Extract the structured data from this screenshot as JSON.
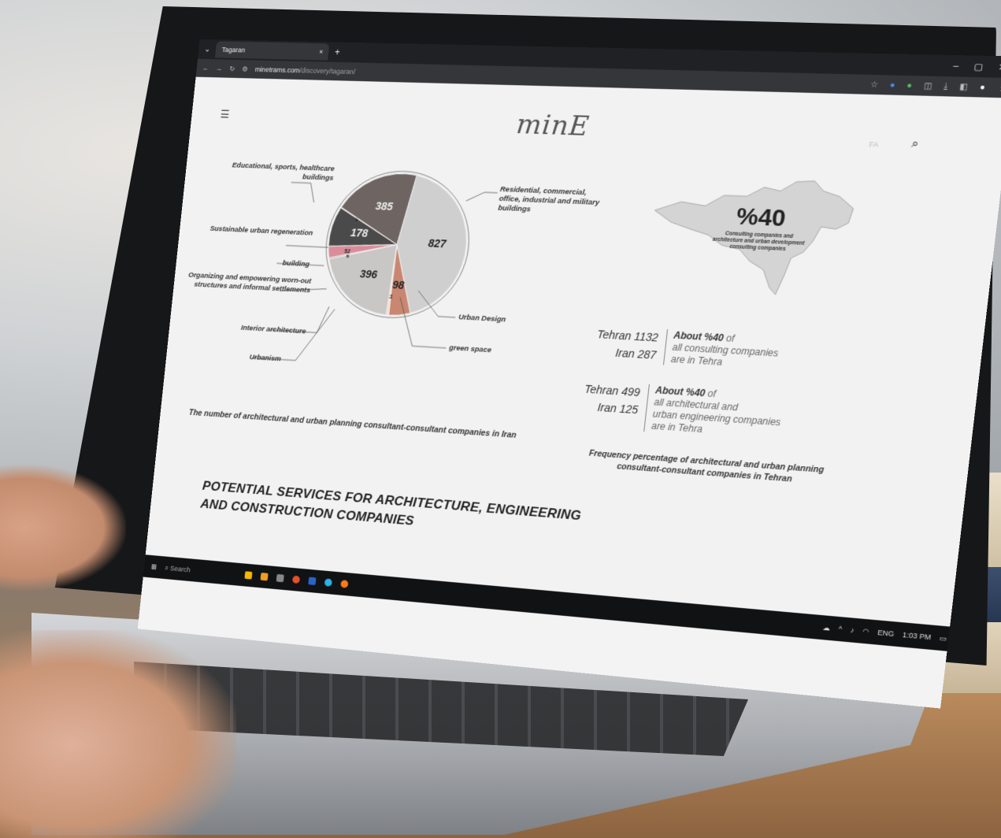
{
  "browser": {
    "tab_title": "Tagaran",
    "tab_close": "×",
    "new_tab": "+",
    "window_controls": [
      "–",
      "▢",
      "✕"
    ],
    "url_host": "minetrams.com",
    "url_path": "/discovery/tagaran/"
  },
  "site": {
    "logo": "minE",
    "lang": "FA"
  },
  "pie": {
    "labels": {
      "educational": "Educational, sports, healthcare buildings",
      "sustainable": "Sustainable urban regeneration",
      "building": "building",
      "organizing": "Organizing and empowering worn-out structures and informal settlements",
      "interior": "Interior architecture",
      "urbanism": "Urbanism",
      "residential": "Residential, commercial, office, industrial and military buildings",
      "urban_design": "Urban Design",
      "green_space": "green space"
    },
    "caption": "The number of architectural and urban planning consultant-consultant companies in Iran"
  },
  "chart_data": {
    "type": "pie",
    "categories": [
      "Residential, commercial, office, industrial and military buildings",
      "Urban Design",
      "green space",
      "Urbanism",
      "Interior architecture",
      "Organizing and empowering worn-out structures and informal settlements",
      "building",
      "Sustainable urban regeneration",
      "Educational, sports, healthcare buildings"
    ],
    "values": [
      827,
      98,
      11,
      396,
      6,
      52,
      178,
      3,
      385
    ],
    "value_labels": [
      "827",
      "98",
      "11",
      "396",
      "6",
      "52",
      "178",
      "3",
      "385"
    ],
    "colors": [
      "#cfcfcf",
      "#c98670",
      "#f3dcc8",
      "#c9c6c6",
      "#9a8f8a",
      "#d98d9a",
      "#4a4a4a",
      "#e0e0e0",
      "#6e6563"
    ],
    "title": "",
    "legend": "callout-labels"
  },
  "map": {
    "percent": "%40",
    "caption": "Consulting companies and architecture and urban development consulting companies",
    "bottom_caption": "Frequency percentage of architectural and urban planning consultant-consultant companies in Tehran"
  },
  "stats": [
    {
      "left": [
        "Tehran 1132",
        "Iran 287"
      ],
      "bold": "About %40",
      "rest": [
        "of",
        "all consulting companies",
        "are in Tehra"
      ]
    },
    {
      "left": [
        "Tehran 499",
        "Iran 125"
      ],
      "bold": "About %40",
      "rest": [
        "of",
        "all architectural and",
        "urban engineering companies",
        "are in Tehra"
      ]
    }
  ],
  "services": {
    "heading_line1": "POTENTIAL SERVICES FOR ARCHITECTURE, ENGINEERING",
    "heading_line2": "AND CONSTRUCTION COMPANIES"
  },
  "taskbar": {
    "search_placeholder": "Search",
    "lang": "ENG",
    "time": "1:03 PM"
  },
  "colors": {
    "page_bg": "#f2f2f2",
    "browser_chrome": "#202124",
    "map_fill": "#d4d4d4"
  }
}
